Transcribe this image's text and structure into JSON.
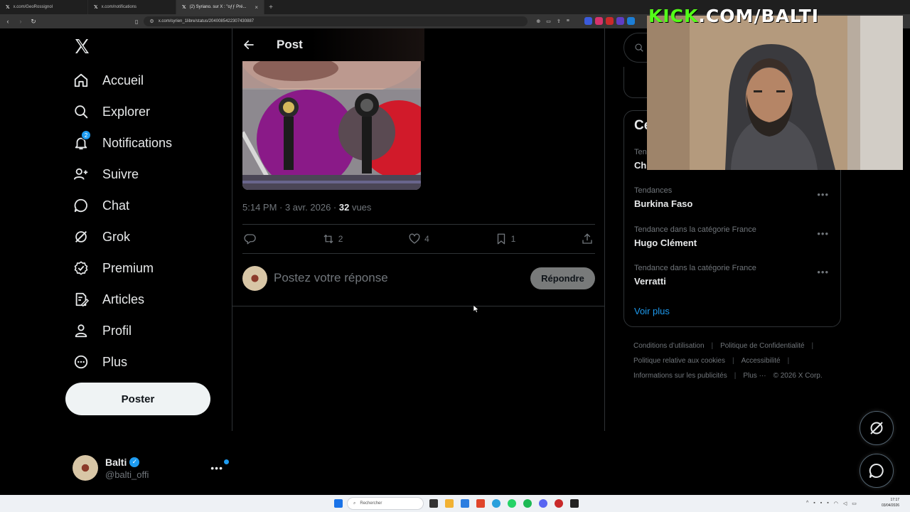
{
  "browser": {
    "tabs": [
      {
        "label": "x.com/GeoRossignol",
        "active": false
      },
      {
        "label": "x.com/notifications",
        "active": false
      },
      {
        "label": "(2) Syriano. sur X : \"oƒƒ Pré...",
        "active": true
      }
    ],
    "url": "x.com/syrien_1libre/status/2040085422307430887"
  },
  "stream_overlay": {
    "brand_green": "KICK",
    "brand_rest": ".COM/BALTI"
  },
  "nav": {
    "items": [
      {
        "label": "Accueil",
        "icon": "home-icon"
      },
      {
        "label": "Explorer",
        "icon": "search-icon"
      },
      {
        "label": "Notifications",
        "icon": "bell-icon"
      },
      {
        "label": "Suivre",
        "icon": "add-user-icon"
      },
      {
        "label": "Chat",
        "icon": "chat-icon"
      },
      {
        "label": "Grok",
        "icon": "grok-icon"
      },
      {
        "label": "Premium",
        "icon": "premium-icon"
      },
      {
        "label": "Articles",
        "icon": "articles-icon"
      },
      {
        "label": "Profil",
        "icon": "user-icon"
      },
      {
        "label": "Plus",
        "icon": "more-circle-icon"
      }
    ],
    "notifications_badge": "2",
    "post_button": "Poster"
  },
  "account": {
    "name": "Balti",
    "handle": "@balti_offi"
  },
  "post": {
    "header_title": "Post",
    "timestamp": "5:14 PM · 3 avr. 2026 · ",
    "views_count": "32",
    "views_label": " vues",
    "retweets": "2",
    "likes": "4",
    "bookmarks": "1",
    "reply_placeholder": "Postez votre réponse",
    "reply_button": "Répondre"
  },
  "sidebar": {
    "trends_heading_partial": "Ce",
    "first_trend_cat_partial": "Tend",
    "first_trend_name_partial": "Ch",
    "trends": [
      {
        "category": "Tendances",
        "name": "Burkina Faso"
      },
      {
        "category": "Tendance dans la catégorie France",
        "name": "Hugo Clément"
      },
      {
        "category": "Tendance dans la catégorie France",
        "name": "Verratti"
      }
    ],
    "more_link": "Voir plus",
    "footer": {
      "terms": "Conditions d’utilisation",
      "privacy": "Politique de Confidentialité",
      "cookies": "Politique relative aux cookies",
      "accessibility": "Accessibilité",
      "ads": "Informations sur les publicités",
      "more": "Plus ···",
      "copyright": "© 2026 X Corp."
    }
  },
  "taskbar": {
    "search_placeholder": "Rechercher",
    "time": "17:17",
    "date": "03/04/2026"
  },
  "colors": {
    "accent": "#1d9bf0",
    "background": "#000000",
    "kick_green": "#53fc18"
  }
}
